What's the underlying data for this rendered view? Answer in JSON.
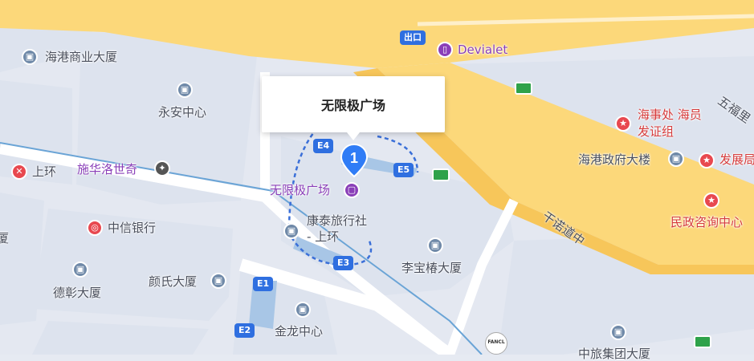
{
  "popup": {
    "title": "无限极广场"
  },
  "pin": {
    "number": "1"
  },
  "main_poi": {
    "label": "无限极广场"
  },
  "pois": {
    "haigang_commercial": "海港商业大厦",
    "wingon": "永安中心",
    "swarovski": "施华洛世奇",
    "sheung_wan": "上环",
    "citic": "中信银行",
    "hong_thai": "康泰旅行社",
    "hong_thai_sub": "- 上环",
    "li_po_chun": "李宝椿大厦",
    "tak_cheong": "德彰大厦",
    "ngan_shi": "颜氏大厦",
    "kam_lung": "金龙中心",
    "devialet": "Devialet",
    "marine_dept": "海事处 海员",
    "marine_dept_2": "发证组",
    "harbour_gov": "海港政府大楼",
    "development": "发展局",
    "civil_affairs": "民政咨询中心",
    "china_merchants": "中旅集团大厦",
    "left_edge": "厦"
  },
  "roads": {
    "connaught": "干诺道中",
    "five_blessings": "五福里"
  },
  "exits": {
    "E1": "E1",
    "E2": "E2",
    "E3": "E3",
    "E4": "E4",
    "E5": "E5",
    "exit_label": "出口"
  },
  "fancl": "FANCL",
  "colors": {
    "highway": "#fcd87a",
    "pin": "#2f7cf6",
    "purple": "#8a3fb8",
    "red": "#e8484f",
    "bus": "#2ea24a",
    "exit": "#2f6fe0"
  }
}
